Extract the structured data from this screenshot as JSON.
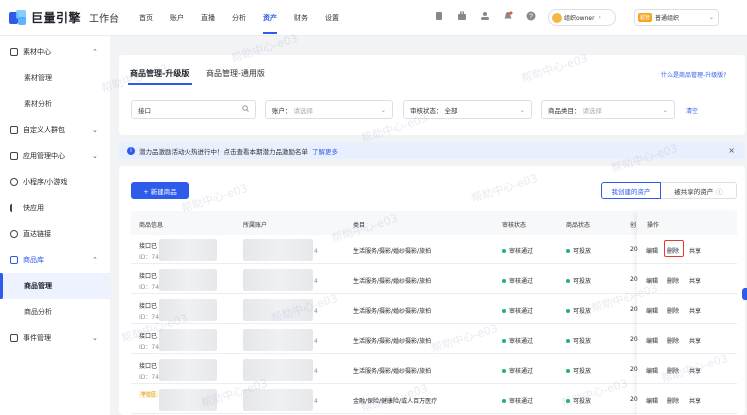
{
  "app": {
    "brand": "巨量引擎",
    "product": "工作台"
  },
  "nav": {
    "items": [
      "首页",
      "账户",
      "直播",
      "分析",
      "资产",
      "财务",
      "设置"
    ],
    "active": "资产"
  },
  "top": {
    "account": "组织owner",
    "org_badge": "超管",
    "org_name": "普通组织"
  },
  "sidebar": {
    "items": [
      {
        "label": "素材中心",
        "type": "group",
        "expanded": true
      },
      {
        "label": "素材管理",
        "type": "sub"
      },
      {
        "label": "素材分析",
        "type": "sub"
      },
      {
        "label": "自定义人群包",
        "type": "group",
        "expanded": false
      },
      {
        "label": "应用管理中心",
        "type": "group",
        "expanded": false
      },
      {
        "label": "小程序/小游戏",
        "type": "group"
      },
      {
        "label": "快应用",
        "type": "group"
      },
      {
        "label": "直达链接",
        "type": "group"
      },
      {
        "label": "商品库",
        "type": "group",
        "expanded": true
      },
      {
        "label": "商品管理",
        "type": "sub",
        "active": true
      },
      {
        "label": "商品分析",
        "type": "sub"
      },
      {
        "label": "事件管理",
        "type": "group",
        "expanded": false
      }
    ]
  },
  "tabs": {
    "items": [
      "商品管理-升级版",
      "商品管理-通用版"
    ],
    "active": "商品管理-升级版",
    "help_link": "什么是商品管理-升级版?"
  },
  "filters": {
    "search_value": "接口",
    "account_label": "账户：",
    "account_placeholder": "请选择",
    "review_label": "审核状态：",
    "review_value": "全部",
    "category_label": "商品类目：",
    "category_placeholder": "请选择",
    "clear": "清空"
  },
  "notice": {
    "text": "潜力品激励活动火热进行中！点击查看本期潜力品激励名单",
    "link": "了解更多"
  },
  "actions": {
    "new_product": "+ 新建商品",
    "my_assets": "我创建的资产",
    "shared_assets": "被共享的资产"
  },
  "table": {
    "headers": [
      "商品信息",
      "所属账户",
      "类目",
      "审核状态",
      "商品状态",
      "创",
      "操作"
    ],
    "rows": [
      {
        "name": "接口已",
        "id": "ID：74",
        "account_suffix": "4",
        "category": "生活服务/摄影/婚纱摄影/旅拍",
        "review": "审核通过",
        "status": "可投放",
        "created": "20",
        "tag": ""
      },
      {
        "name": "接口已",
        "id": "ID：74",
        "account_suffix": "4",
        "category": "生活服务/摄影/婚纱摄影/旅拍",
        "review": "审核通过",
        "status": "可投放",
        "created": "20",
        "tag": ""
      },
      {
        "name": "接口已",
        "id": "ID：74",
        "account_suffix": "4",
        "category": "生活服务/摄影/婚纱摄影/旅拍",
        "review": "审核通过",
        "status": "可投放",
        "created": "20",
        "tag": ""
      },
      {
        "name": "接口已",
        "id": "ID：74",
        "account_suffix": "4",
        "category": "生活服务/摄影/婚纱摄影/旅拍",
        "review": "审核通过",
        "status": "可投放",
        "created": "20",
        "tag": ""
      },
      {
        "name": "接口已",
        "id": "ID：74",
        "account_suffix": "4",
        "category": "生活服务/摄影/婚纱摄影/旅拍",
        "review": "审核通过",
        "status": "可投放",
        "created": "20",
        "tag": ""
      },
      {
        "name": "",
        "id": "",
        "account_suffix": "4",
        "category": "金融/保险/健康险/或人百万医疗",
        "review": "审核通过",
        "status": "可投放",
        "created": "20",
        "tag": "学位区"
      }
    ],
    "ops": {
      "edit": "编辑",
      "delete": "删除",
      "share": "共享"
    }
  },
  "watermark": "帮助中心-e03",
  "colors": {
    "primary": "#2f5bea",
    "success": "#21b36a",
    "highlight": "#e53935"
  }
}
